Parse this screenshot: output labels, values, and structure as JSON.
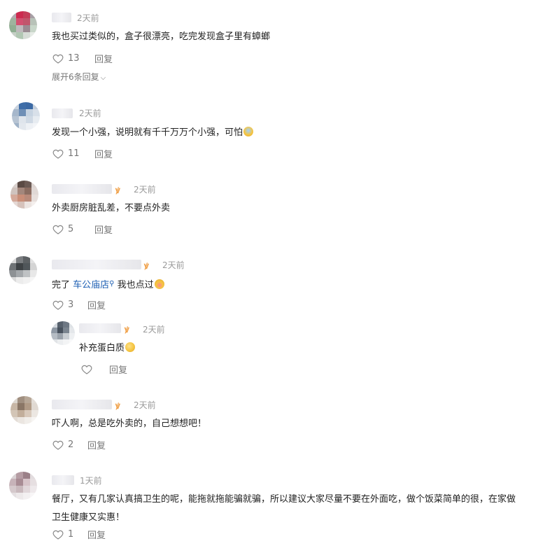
{
  "comments": [
    {
      "time": "2天前",
      "text": "我也买过类似的，盒子很漂亮，吃完发现盒子里有蟑螂",
      "likes": "13",
      "reply": "回复",
      "expand": "展开6条回复"
    },
    {
      "time": "2天前",
      "text": "发现一个小强，说明就有千千万万个小强，可怕",
      "likes": "11",
      "reply": "回复"
    },
    {
      "time": "2天前",
      "text": "外卖厨房脏乱差，不要点外卖",
      "likes": "5",
      "reply": "回复"
    },
    {
      "time": "2天前",
      "text_before": "完了 ",
      "link": "车公庙店",
      "text_after": " 我也点过",
      "likes": "3",
      "reply": "回复"
    },
    {
      "time": "2天前",
      "text": "补充蛋白质",
      "likes": "",
      "reply": "回复"
    },
    {
      "time": "2天前",
      "text": "吓人啊，总是吃外卖的，自己想想吧！",
      "likes": "2",
      "reply": "回复"
    },
    {
      "time": "1天前",
      "text_line1": "餐厅，又有几家认真搞卫生的呢，能拖就拖能骗就骗，所以建议大家尽量不要在外面吃，做个饭菜简单的很，在家做",
      "text_line2": "卫生健康又实惠！",
      "likes": "1",
      "reply": "回复"
    }
  ],
  "icons": {
    "like": "heart-outline-icon",
    "vip": "vip-badge-icon",
    "search": "search-icon",
    "chevron": "chevron-down-icon"
  },
  "colors": {
    "vip": "#f0a14a",
    "link": "#1d5fb3",
    "muted": "#9a9a9a"
  }
}
